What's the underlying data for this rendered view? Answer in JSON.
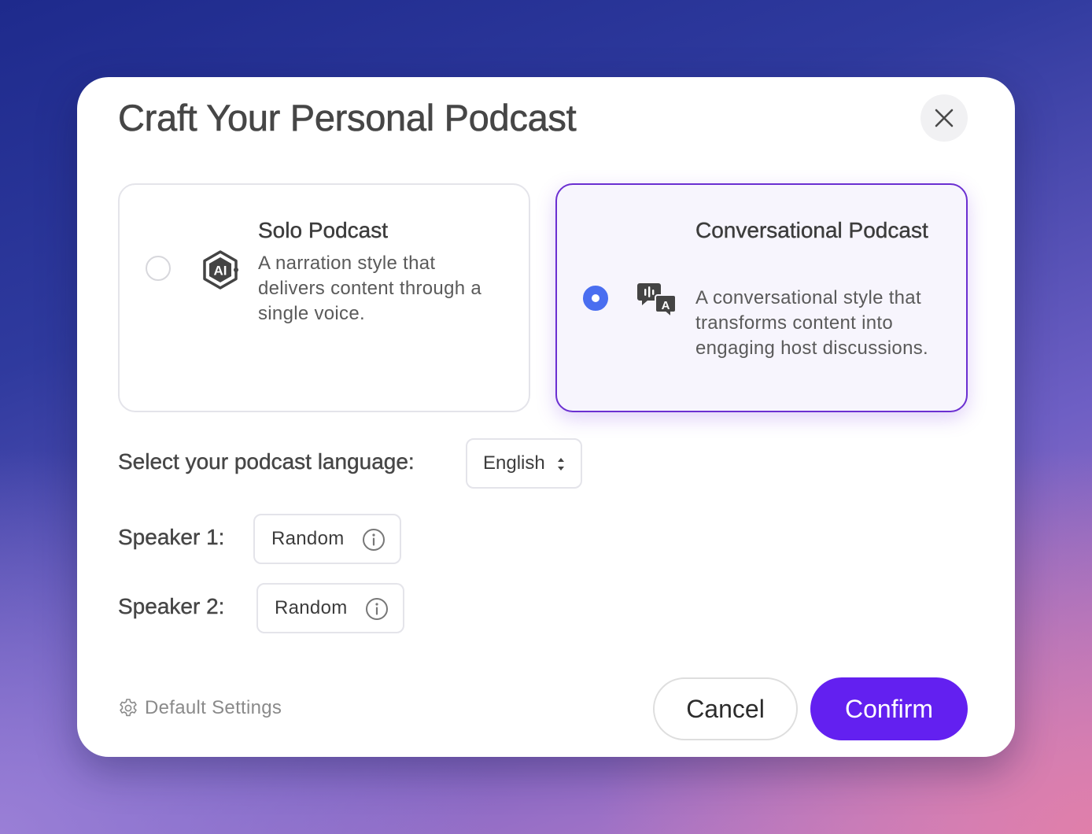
{
  "dialog": {
    "title": "Craft Your Personal Podcast"
  },
  "options": {
    "solo": {
      "title": "Solo Podcast",
      "description": "A narration style that delivers content through a single voice.",
      "selected": false,
      "icon": "ai-badge-icon"
    },
    "conversational": {
      "title": "Conversational Podcast",
      "description": "A conversational style that transforms content into engaging host discussions.",
      "selected": true,
      "icon": "chat-bubbles-icon"
    }
  },
  "language": {
    "label": "Select your podcast language:",
    "value": "English"
  },
  "speakers": [
    {
      "label": "Speaker 1:",
      "value": "Random"
    },
    {
      "label": "Speaker 2:",
      "value": "Random"
    }
  ],
  "footer": {
    "default_settings": "Default Settings",
    "cancel": "Cancel",
    "confirm": "Confirm"
  },
  "colors": {
    "accent": "#6320f0",
    "selected_border": "#6b2fd1",
    "radio_on": "#4a6ef0"
  }
}
